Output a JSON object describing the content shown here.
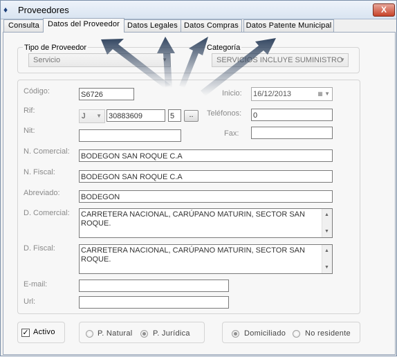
{
  "window": {
    "title": "Proveedores",
    "close_label": "X",
    "app_icon": "app-icon"
  },
  "tabs": [
    {
      "label": "Consulta"
    },
    {
      "label": "Datos del Proveedor"
    },
    {
      "label": "Datos Legales"
    },
    {
      "label": "Datos Compras"
    },
    {
      "label": "Datos Patente Municipal"
    }
  ],
  "top": {
    "tipo_label": "Tipo de Proveedor",
    "tipo_value": "Servicio",
    "categoria_label": "Categoría",
    "categoria_value": "SERVICIOS INCLUYE SUMINISTRO"
  },
  "form": {
    "codigo_label": "Código:",
    "codigo_value": "S6726",
    "inicio_label": "Inicio:",
    "inicio_value": "16/12/2013",
    "rif_label": "Rif:",
    "rif_type": "J",
    "rif_number": "30883609",
    "rif_digit": "5",
    "rif_button": "..",
    "telefonos_label": "Teléfonos:",
    "telefonos_value": "0",
    "nit_label": "Nit:",
    "nit_value": "",
    "fax_label": "Fax:",
    "fax_value": "",
    "ncomercial_label": "N. Comercial:",
    "ncomercial_value": "BODEGON SAN ROQUE C.A",
    "nfiscal_label": "N. Fiscal:",
    "nfiscal_value": "BODEGON SAN ROQUE C.A",
    "abreviado_label": "Abreviado:",
    "abreviado_value": "BODEGON",
    "dcomercial_label": "D. Comercial:",
    "dcomercial_value": "CARRETERA NACIONAL, CARÚPANO MATURIN, SECTOR SAN ROQUE.",
    "dfiscal_label": "D. Fiscal:",
    "dfiscal_value": "CARRETERA NACIONAL, CARÚPANO MATURIN, SECTOR SAN ROQUE.",
    "email_label": "E-mail:",
    "email_value": "",
    "url_label": "Url:",
    "url_value": ""
  },
  "bottom": {
    "activo_label": "Activo",
    "activo_checked": true,
    "p_natural": "P. Natural",
    "p_juridica": "P. Jurídica",
    "domiciliado": "Domiciliado",
    "no_residente": "No residente"
  },
  "colors": {
    "accent": "#1d3f7a",
    "close": "#c7432a",
    "arrow": "#2a3e5a"
  }
}
